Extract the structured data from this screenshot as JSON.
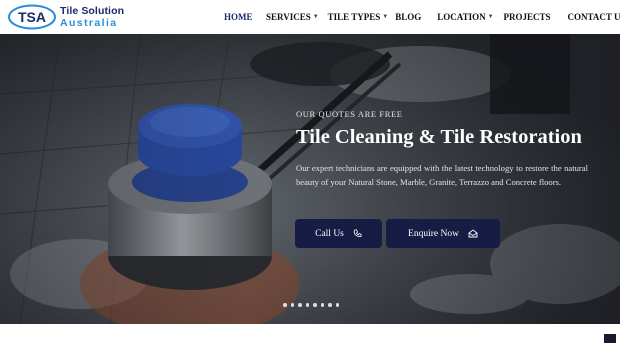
{
  "brand": {
    "logo_mark": "TSA",
    "line1": "Tile Solution",
    "line2": "Australia",
    "colors": {
      "navy": "#1b2a6b",
      "blue": "#2b8fd6"
    }
  },
  "nav": {
    "items": [
      {
        "label": "HOME",
        "active": true,
        "has_dropdown": false
      },
      {
        "label": "SERVICES",
        "active": false,
        "has_dropdown": true
      },
      {
        "label": "TILE TYPES",
        "active": false,
        "has_dropdown": true
      },
      {
        "label": "BLOG",
        "active": false,
        "has_dropdown": false
      },
      {
        "label": "LOCATION",
        "active": false,
        "has_dropdown": true
      },
      {
        "label": "PROJECTS",
        "active": false,
        "has_dropdown": false
      },
      {
        "label": "CONTACT US",
        "active": false,
        "has_dropdown": false
      }
    ]
  },
  "hero": {
    "kicker": "OUR QUOTES ARE FREE",
    "title": "Tile Cleaning & Tile Restoration",
    "description": "Our expert technicians are equipped with the latest technology to restore the natural beauty of your Natural Stone,  Marble, Granite, Terrazzo and Concrete floors.",
    "buttons": {
      "call": {
        "label": "Call Us",
        "icon": "phone-icon"
      },
      "enquire": {
        "label": "Enquire Now",
        "icon": "envelope-icon"
      }
    },
    "slider_dots": 8,
    "button_color": "#161c44"
  }
}
